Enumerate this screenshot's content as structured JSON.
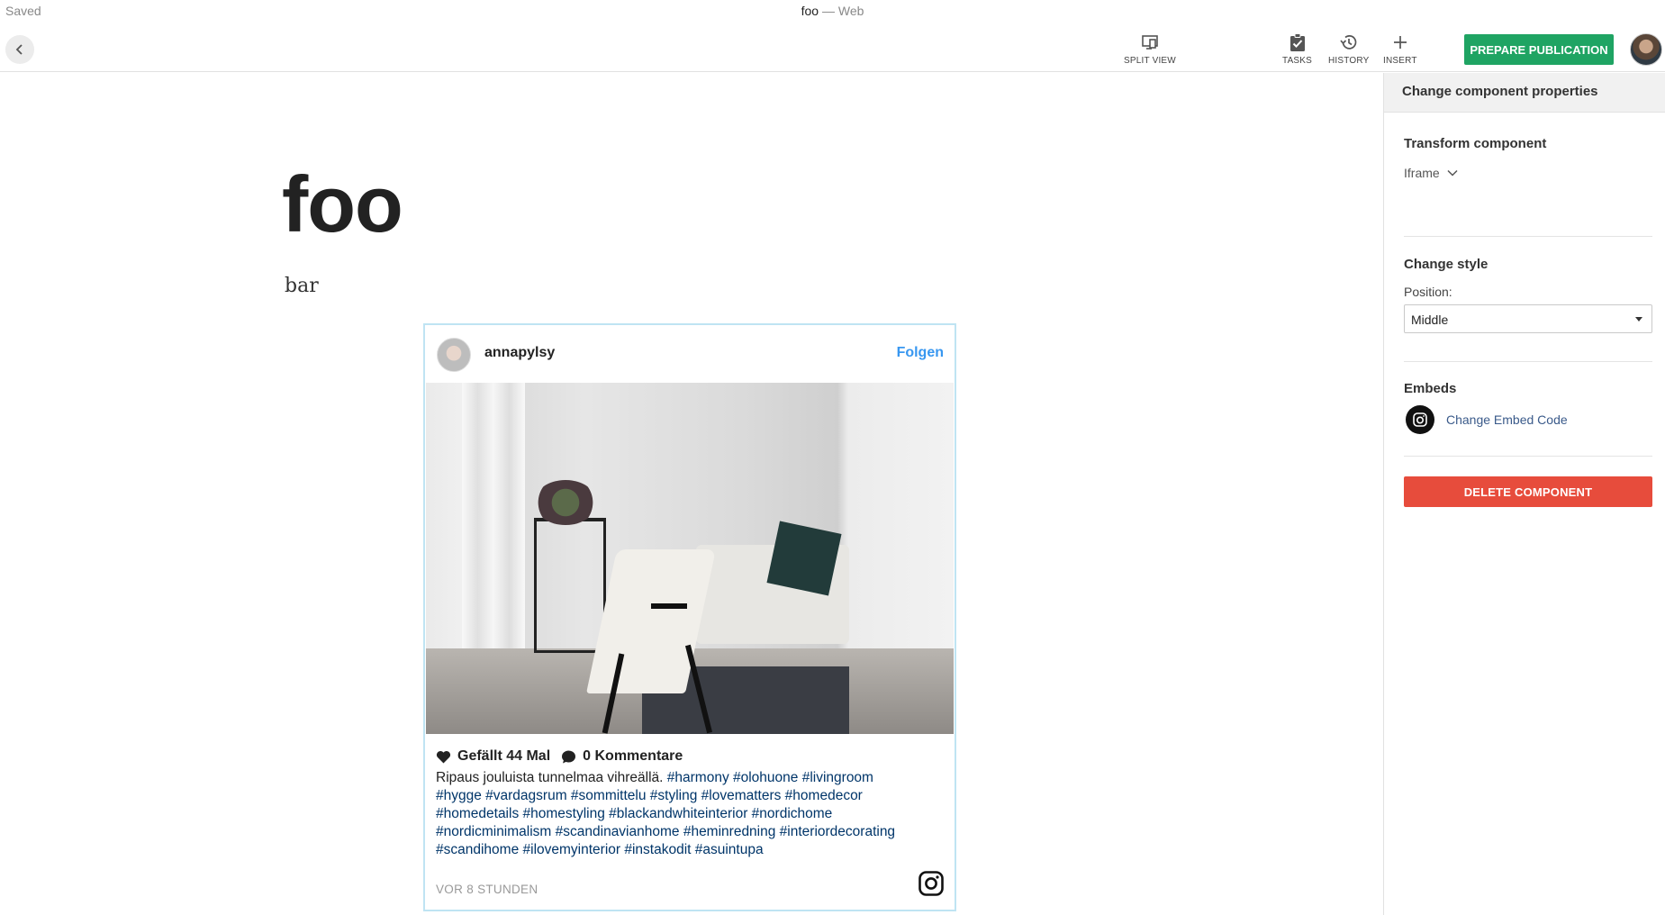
{
  "topbar": {
    "status": "Saved",
    "doc_name": "foo",
    "doc_channel": " — Web",
    "tools": {
      "split_view": "SPLIT VIEW",
      "tasks": "TASKS",
      "history": "HISTORY",
      "insert": "INSERT"
    },
    "publish_label": "PREPARE PUBLICATION"
  },
  "editor": {
    "heading": "foo",
    "paragraph": "bar",
    "instagram": {
      "username": "annapylsy",
      "follow_label": "Folgen",
      "likes": "Gefällt 44 Mal",
      "comments": "0 Kommentare",
      "caption_text": "Ripaus jouluista tunnelmaa vihreällä. ",
      "caption_tags": "#harmony #olohuone #livingroom #hygge #vardagsrum #sommittelu #styling #lovematters #homedecor #homedetails #homestyling #blackandwhiteinterior #nordichome #nordicminimalism #scandinavianhome #heminredning #interiordecorating #scandihome #ilovemyinterior #instakodit #asuintupa",
      "timestamp": "VOR 8 STUNDEN"
    }
  },
  "panel": {
    "header": "Change component properties",
    "transform_title": "Transform component",
    "transform_value": "Iframe",
    "style_title": "Change style",
    "position_label": "Position:",
    "position_value": "Middle",
    "embeds_title": "Embeds",
    "change_embed_label": "Change Embed Code",
    "delete_label": "DELETE COMPONENT"
  },
  "colors": {
    "publish": "#1fa463",
    "delete": "#e74c3c",
    "follow": "#3897f0",
    "embed_border": "#bfe4f3"
  }
}
